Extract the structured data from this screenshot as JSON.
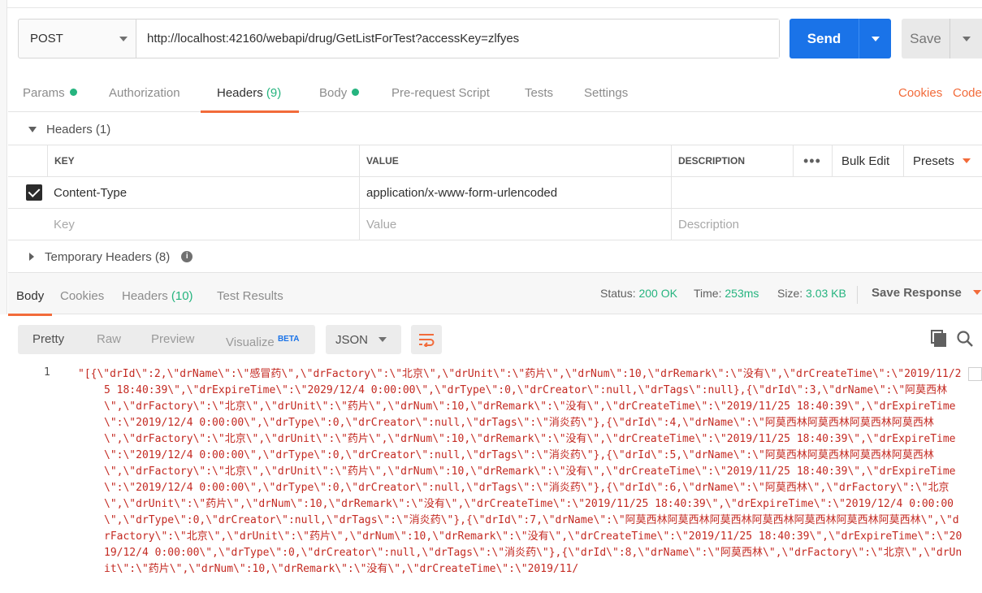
{
  "request": {
    "method": "POST",
    "url": "http://localhost:42160/webapi/drug/GetListForTest?accessKey=zlfyes",
    "send_label": "Send",
    "save_label": "Save"
  },
  "request_tabs": {
    "params": "Params",
    "authorization": "Authorization",
    "headers": "Headers",
    "headers_count": "(9)",
    "body": "Body",
    "prerequest": "Pre-request Script",
    "tests": "Tests",
    "settings": "Settings",
    "cookies": "Cookies",
    "code": "Code"
  },
  "headers_section": {
    "title": "Headers",
    "count": "(1)",
    "columns": {
      "key": "KEY",
      "value": "VALUE",
      "description": "DESCRIPTION"
    },
    "bulk_edit": "Bulk Edit",
    "presets": "Presets",
    "rows": [
      {
        "checked": true,
        "key": "Content-Type",
        "value": "application/x-www-form-urlencoded",
        "description": ""
      }
    ],
    "placeholders": {
      "key": "Key",
      "value": "Value",
      "description": "Description"
    }
  },
  "temporary_headers": {
    "title": "Temporary Headers",
    "count": "(8)"
  },
  "response_tabs": {
    "body": "Body",
    "cookies": "Cookies",
    "headers": "Headers",
    "headers_count": "(10)",
    "test_results": "Test Results"
  },
  "response_status": {
    "status_label": "Status:",
    "status_value": "200 OK",
    "time_label": "Time:",
    "time_value": "253ms",
    "size_label": "Size:",
    "size_value": "3.03 KB",
    "save_response": "Save Response"
  },
  "view_modes": {
    "pretty": "Pretty",
    "raw": "Raw",
    "preview": "Preview",
    "visualize": "Visualize",
    "beta": "BETA",
    "format": "JSON"
  },
  "code": {
    "line_number": "1",
    "text": "\"[{\\\"drId\\\":2,\\\"drName\\\":\\\"感冒药\\\",\\\"drFactory\\\":\\\"北京\\\",\\\"drUnit\\\":\\\"药片\\\",\\\"drNum\\\":10,\\\"drRemark\\\":\\\"没有\\\",\\\"drCreateTime\\\":\\\"2019/11/25 18:40:39\\\",\\\"drExpireTime\\\":\\\"2029/12/4 0:00:00\\\",\\\"drType\\\":0,\\\"drCreator\\\":null,\\\"drTags\\\":null},{\\\"drId\\\":3,\\\"drName\\\":\\\"阿莫西林\\\",\\\"drFactory\\\":\\\"北京\\\",\\\"drUnit\\\":\\\"药片\\\",\\\"drNum\\\":10,\\\"drRemark\\\":\\\"没有\\\",\\\"drCreateTime\\\":\\\"2019/11/25 18:40:39\\\",\\\"drExpireTime\\\":\\\"2019/12/4 0:00:00\\\",\\\"drType\\\":0,\\\"drCreator\\\":null,\\\"drTags\\\":\\\"消炎药\\\"},{\\\"drId\\\":4,\\\"drName\\\":\\\"阿莫西林阿莫西林阿莫西林阿莫西林\\\",\\\"drFactory\\\":\\\"北京\\\",\\\"drUnit\\\":\\\"药片\\\",\\\"drNum\\\":10,\\\"drRemark\\\":\\\"没有\\\",\\\"drCreateTime\\\":\\\"2019/11/25 18:40:39\\\",\\\"drExpireTime\\\":\\\"2019/12/4 0:00:00\\\",\\\"drType\\\":0,\\\"drCreator\\\":null,\\\"drTags\\\":\\\"消炎药\\\"},{\\\"drId\\\":5,\\\"drName\\\":\\\"阿莫西林阿莫西林阿莫西林阿莫西林\\\",\\\"drFactory\\\":\\\"北京\\\",\\\"drUnit\\\":\\\"药片\\\",\\\"drNum\\\":10,\\\"drRemark\\\":\\\"没有\\\",\\\"drCreateTime\\\":\\\"2019/11/25 18:40:39\\\",\\\"drExpireTime\\\":\\\"2019/12/4 0:00:00\\\",\\\"drType\\\":0,\\\"drCreator\\\":null,\\\"drTags\\\":\\\"消炎药\\\"},{\\\"drId\\\":6,\\\"drName\\\":\\\"阿莫西林\\\",\\\"drFactory\\\":\\\"北京\\\",\\\"drUnit\\\":\\\"药片\\\",\\\"drNum\\\":10,\\\"drRemark\\\":\\\"没有\\\",\\\"drCreateTime\\\":\\\"2019/11/25 18:40:39\\\",\\\"drExpireTime\\\":\\\"2019/12/4 0:00:00\\\",\\\"drType\\\":0,\\\"drCreator\\\":null,\\\"drTags\\\":\\\"消炎药\\\"},{\\\"drId\\\":7,\\\"drName\\\":\\\"阿莫西林阿莫西林阿莫西林阿莫西林阿莫西林阿莫西林阿莫西林\\\",\\\"drFactory\\\":\\\"北京\\\",\\\"drUnit\\\":\\\"药片\\\",\\\"drNum\\\":10,\\\"drRemark\\\":\\\"没有\\\",\\\"drCreateTime\\\":\\\"2019/11/25 18:40:39\\\",\\\"drExpireTime\\\":\\\"2019/12/4 0:00:00\\\",\\\"drType\\\":0,\\\"drCreator\\\":null,\\\"drTags\\\":\\\"消炎药\\\"},{\\\"drId\\\":8,\\\"drName\\\":\\\"阿莫西林\\\",\\\"drFactory\\\":\\\"北京\\\",\\\"drUnit\\\":\\\"药片\\\",\\\"drNum\\\":10,\\\"drRemark\\\":\\\"没有\\\",\\\"drCreateTime\\\":\\\"2019/11/"
  },
  "colors": {
    "accent": "#f26b3a",
    "send": "#1a73e8",
    "status_ok": "#26b47f",
    "string": "#c42a22"
  },
  "icons": {
    "copy": "copy-icon",
    "search": "search-icon",
    "wrap": "wrap-lines-icon",
    "info": "info-icon",
    "more": "more-horizontal-icon"
  }
}
